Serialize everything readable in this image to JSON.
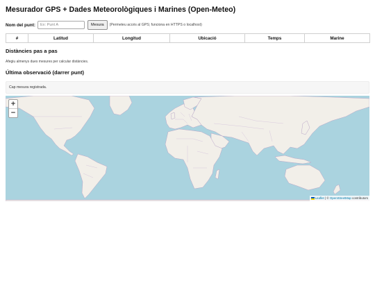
{
  "header": {
    "title": "Mesurador GPS + Dades Meteorològiques i Marines (Open-Meteo)"
  },
  "point": {
    "label": "Nom del punt:",
    "placeholder": "Ex: Punt A",
    "value": "",
    "button": "Mesura",
    "hint": "(Permeteu accés al GPS; funciona en HTTPS o localhost)"
  },
  "table": {
    "columns": [
      "#",
      "Latitud",
      "Longitud",
      "Ubicació",
      "Temps",
      "Marine"
    ],
    "rows": []
  },
  "distances": {
    "title": "Distàncies pas a pas",
    "note": "Afegiu almenys dues mesures per calcular distàncies."
  },
  "last_observation": {
    "title": "Última observació (darrer punt)",
    "empty": "Cap mesura registrada."
  },
  "map": {
    "zoom_in": "+",
    "zoom_out": "−",
    "attribution": {
      "leaflet": "Leaflet",
      "separator": " | © ",
      "osm": "OpenStreetMap",
      "rest": " contributors"
    },
    "colors": {
      "water": "#aad3df",
      "land": "#f2efe9",
      "border": "#b9a6c7"
    }
  }
}
